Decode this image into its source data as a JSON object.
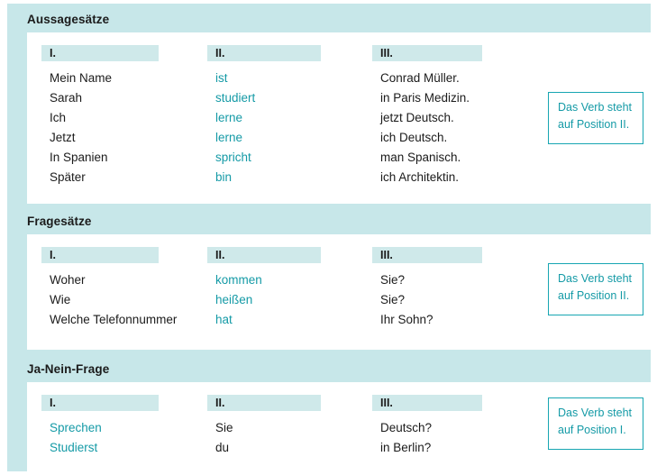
{
  "panel": {
    "accent_teal": "#149aa6",
    "band_teal": "#c7e7e9",
    "chip_teal": "#cfe9ea",
    "text_dark": "#1b1b1b"
  },
  "sections": [
    {
      "title": "Aussagesätze",
      "columns": [
        "I.",
        "II.",
        "III."
      ],
      "rows": [
        {
          "c1": "Mein Name",
          "c2": "ist",
          "c3": "Conrad Müller."
        },
        {
          "c1": "Sarah",
          "c2": "studiert",
          "c3": "in Paris Medizin."
        },
        {
          "c1": "Ich",
          "c2": "lerne",
          "c3": "jetzt Deutsch."
        },
        {
          "c1": "Jetzt",
          "c2": "lerne",
          "c3": "ich Deutsch."
        },
        {
          "c1": "In Spanien",
          "c2": "spricht",
          "c3": "man Spanisch."
        },
        {
          "c1": "Später",
          "c2": "bin",
          "c3": "ich Architektin."
        }
      ],
      "verb_column": "c2",
      "callout": {
        "line1": "Das Verb steht",
        "line2": "auf Position II."
      }
    },
    {
      "title": "Fragesätze",
      "columns": [
        "I.",
        "II.",
        "III."
      ],
      "rows": [
        {
          "c1": "Woher",
          "c2": "kommen",
          "c3": "Sie?"
        },
        {
          "c1": "Wie",
          "c2": "heißen",
          "c3": "Sie?"
        },
        {
          "c1": "Welche Telefonnummer",
          "c2": "hat",
          "c3": "Ihr Sohn?"
        }
      ],
      "verb_column": "c2",
      "callout": {
        "line1": "Das Verb steht",
        "line2": "auf Position II."
      }
    },
    {
      "title": "Ja-Nein-Frage",
      "columns": [
        "I.",
        "II.",
        "III."
      ],
      "rows": [
        {
          "c1": "Sprechen",
          "c2": "Sie",
          "c3": "Deutsch?"
        },
        {
          "c1": "Studierst",
          "c2": "du",
          "c3": "in Berlin?"
        }
      ],
      "verb_column": "c1",
      "callout": {
        "line1": "Das Verb steht",
        "line2": "auf Position I."
      }
    }
  ]
}
